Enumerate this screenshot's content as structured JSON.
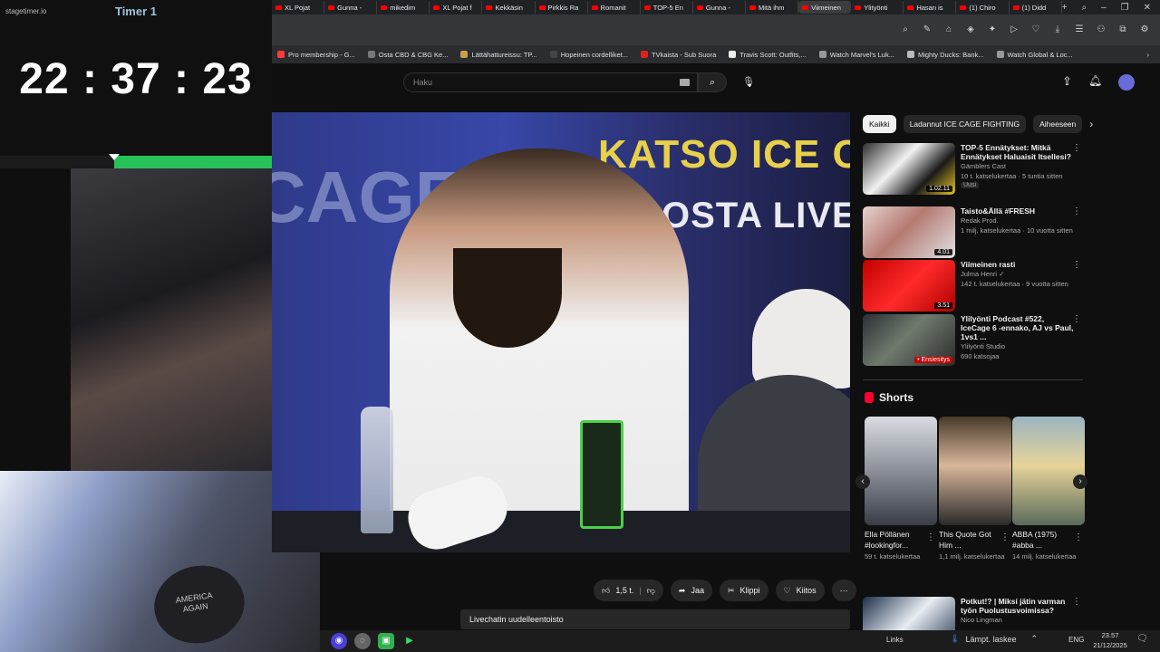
{
  "timer": {
    "logo": "stagetimer.io",
    "title": "Timer 1",
    "clock": "22:37:23",
    "progress_fraction": 0.58
  },
  "browser": {
    "tabs": [
      {
        "label": "XL Pojat"
      },
      {
        "label": "Gunna -"
      },
      {
        "label": "mikedim"
      },
      {
        "label": "XL Pojat f"
      },
      {
        "label": "Kekkäsin"
      },
      {
        "label": "Pirkkis Ra"
      },
      {
        "label": "Romanit"
      },
      {
        "label": "TOP-5 En"
      },
      {
        "label": "Gunna -"
      },
      {
        "label": "Mitä ihm"
      },
      {
        "label": "Viimeinen"
      },
      {
        "label": "Ylityönti"
      },
      {
        "label": "Hasan is"
      },
      {
        "label": "(1) Chiro"
      },
      {
        "label": "(1) Didd"
      }
    ],
    "bookmarks": [
      {
        "label": "Pro membership - G..."
      },
      {
        "label": "Osta CBD & CBG Ke..."
      },
      {
        "label": "Lättähattureissu: TP..."
      },
      {
        "label": "Hopeinen cordelliket..."
      },
      {
        "label": "TVkaista - Sub Suora"
      },
      {
        "label": "Travis Scott: Outfits,..."
      },
      {
        "label": "Watch Marvel's Luk..."
      },
      {
        "label": "Mighty Ducks: Bank..."
      },
      {
        "label": "Watch Global & Loc..."
      }
    ]
  },
  "youtube": {
    "search_placeholder": "Haku",
    "video_overlay_line1": "KATSO ICE CA",
    "video_overlay_line2": "OSTA LIVE",
    "video_bg_text": "CAGE.F",
    "actions": {
      "like_count": "1,5 t.",
      "share": "Jaa",
      "clip": "Klippi",
      "thanks": "Kiitos"
    },
    "live_chat_label": "Livechatin uudelleentoisto",
    "chips": [
      "Kaikki",
      "Ladannut ICE CAGE FIGHTING",
      "Aiheeseen"
    ],
    "recommendations": [
      {
        "title": "TOP-5 Ennätykset: Mitkä Ennätykset Haluaisit Itsellesi?",
        "channel": "Gämblers Cast",
        "meta": "10 t. katselukertaa · 5 tuntia sitten",
        "badge": "Uusi",
        "duration": "1.02.11"
      },
      {
        "title": "Taisto&Ällä #FRESH",
        "channel": "Redak Prod.",
        "meta": "1 milj. katselukertaa · 10 vuotta sitten",
        "badge": "",
        "duration": "4.01"
      },
      {
        "title": "Viimeinen rasti",
        "channel": "Julma Henri ✓",
        "meta": "142 t. katselukertaa · 9 vuotta sitten",
        "badge": "",
        "duration": "3.51"
      },
      {
        "title": "Ylilyönti Podcast #522, IceCage 6 -ennako, AJ vs Paul, 1vs1 ...",
        "channel": "Ylilyönti Studio",
        "meta": "690 katsojaa",
        "badge": "",
        "duration": "• Ensiesitys"
      }
    ],
    "shorts_heading": "Shorts",
    "shorts": [
      {
        "title": "Ella Pöllänen #lookingfor...",
        "views": "59 t. katselukertaa"
      },
      {
        "title": "This Quote Got Him ...",
        "views": "1,1 milj. katselukertaa"
      },
      {
        "title": "ABBA (1975) #abba ...",
        "views": "14 milj. katselukertaa"
      }
    ],
    "next_rec": {
      "title": "Potkut!? | Miksi jätin varman työn Puolustusvoimissa?",
      "channel": "Nico Lingman"
    }
  },
  "taskbar": {
    "links": "Links",
    "weather": "Lämpt. laskee",
    "lang": "ENG",
    "time": "23.57",
    "date": "21/12/2025"
  }
}
